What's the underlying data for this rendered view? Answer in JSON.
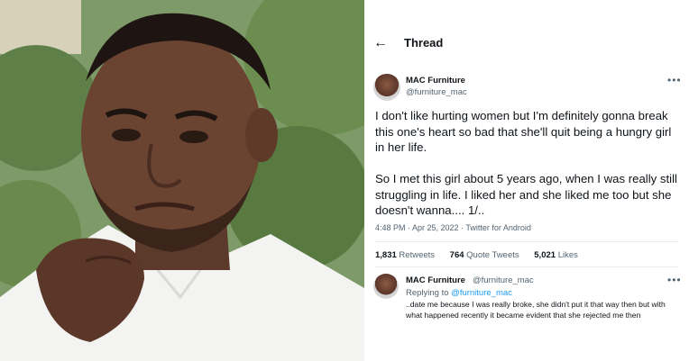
{
  "photo": {
    "description_icon": "portrait-photo"
  },
  "header": {
    "back_icon": "arrow-left-icon",
    "title": "Thread"
  },
  "tweet": {
    "display_name": "MAC Furniture",
    "handle": "@furniture_mac",
    "more_icon": "more-horizontal-icon",
    "body_p1": "I don't like hurting women but I'm definitely gonna break this one's heart so bad that she'll quit being a hungry girl in her life.",
    "body_p2": "So I met this girl about 5 years ago, when I was really still struggling in life. I liked her and she liked me too but she doesn't wanna.... 1/..",
    "meta": "4:48 PM · Apr 25, 2022 · Twitter for Android",
    "retweets_count": "1,831",
    "retweets_label": "Retweets",
    "quotes_count": "764",
    "quotes_label": "Quote Tweets",
    "likes_count": "5,021",
    "likes_label": "Likes"
  },
  "reply": {
    "display_name": "MAC Furniture",
    "handle": "@furniture_mac",
    "replying_prefix": "Replying to",
    "replying_to": "@furniture_mac",
    "body": "..date me because I was really broke, she didn't put it that way then but with what happened recently it became evident that she rejected me then"
  }
}
